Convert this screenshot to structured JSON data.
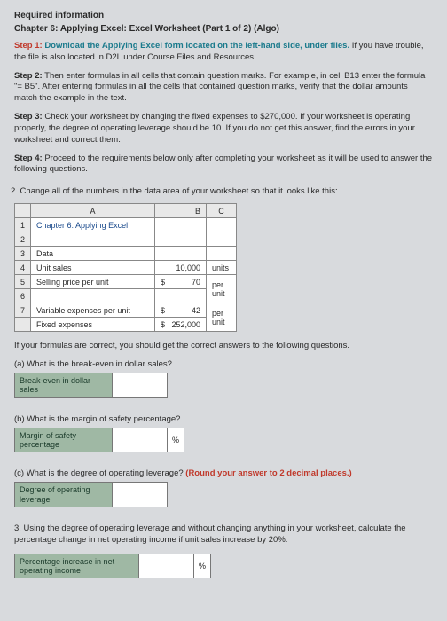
{
  "required_title": "Required information",
  "chapter_title": "Chapter 6: Applying Excel: Excel Worksheet (Part 1 of 2) (Algo)",
  "step1": {
    "label": "Step 1: ",
    "link": "Download the Applying Excel form located on the left-hand side, under files.",
    "rest": " If you have trouble, the file is also located in D2L under Course Files and Resources."
  },
  "step2": {
    "label": "Step 2:",
    "text": " Then enter formulas in all cells that contain question marks. For example, in cell B13 enter the formula \"= B5\". After entering formulas in all the cells that contained question marks, verify that the dollar amounts match the example in the text."
  },
  "step3": {
    "label": "Step 3:",
    "text": " Check your worksheet by changing the fixed expenses to $270,000. If your worksheet is operating properly, the degree of operating leverage should be 10. If you do not get this answer, find the errors in your worksheet and correct them."
  },
  "step4": {
    "label": "Step 4:",
    "text": " Proceed to the requirements below only after completing your worksheet as it will be used to answer the following questions."
  },
  "question2": "2. Change all of the numbers in the data area of your worksheet so that it looks like this:",
  "table": {
    "headers": {
      "a": "A",
      "b": "B",
      "c": "C"
    },
    "rows": {
      "r1a": "Chapter 6: Applying Excel",
      "r3a": "Data",
      "r4a": "Unit sales",
      "r4b": "10,000",
      "r4c": "units",
      "r5a": "Selling price per unit",
      "r5b_sym": "$",
      "r5b": "70",
      "r5c": "per unit",
      "r7a": "Variable expenses per unit",
      "r7b_sym": "$",
      "r7b": "42",
      "r7c": "per unit",
      "r8a": "Fixed expenses",
      "r8b_sym": "$",
      "r8b": "252,000"
    }
  },
  "after_table": "If your formulas are correct, you should get the correct answers to the following questions.",
  "qa": "(a) What is the break-even in dollar sales?",
  "qa_label": "Break-even in dollar sales",
  "qb": "(b) What is the margin of safety percentage?",
  "qb_label": "Margin of safety percentage",
  "pct": "%",
  "qc_pre": "(c) What is the degree of operating leverage? ",
  "qc_round": "(Round your answer to 2 decimal places.)",
  "qc_label": "Degree of operating leverage",
  "q3": "3. Using the degree of operating leverage and without changing anything in your worksheet, calculate the percentage change in net operating income if unit sales increase by 20%.",
  "q3_label": "Percentage increase in net operating income"
}
